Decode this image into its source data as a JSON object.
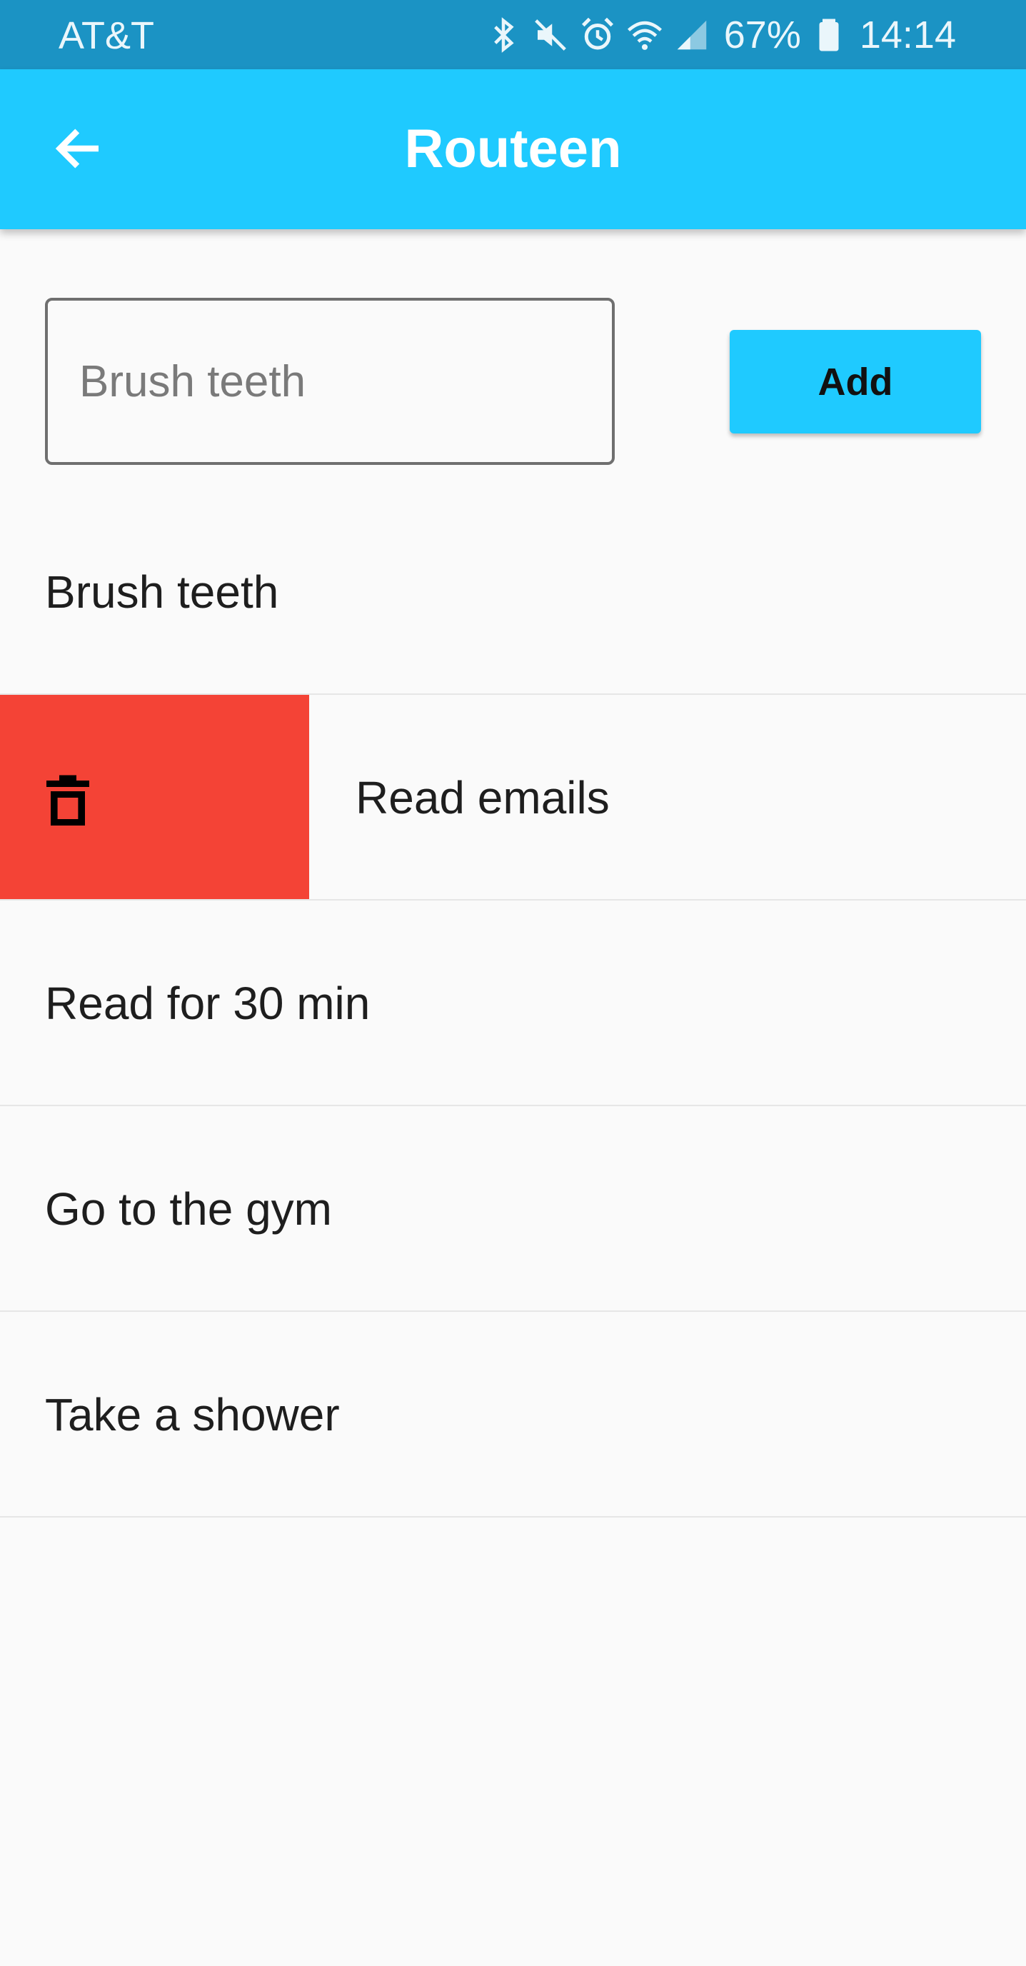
{
  "status_bar": {
    "carrier": "AT&T",
    "battery": "67%",
    "time": "14:14",
    "icons": [
      "bluetooth-icon",
      "mute-icon",
      "alarm-icon",
      "wifi-icon",
      "signal-icon",
      "battery-icon"
    ]
  },
  "app_bar": {
    "title": "Routeen",
    "back_icon": "arrow-back-icon"
  },
  "input": {
    "placeholder": "Brush teeth",
    "value": ""
  },
  "add_button": {
    "label": "Add"
  },
  "colors": {
    "status_bar": "#1b93c4",
    "app_bar": "#1fcaff",
    "delete": "#f44336",
    "background": "#fafafa"
  },
  "tasks": [
    {
      "label": "Brush teeth"
    },
    {
      "label": "Read emails",
      "swiped": true,
      "swipe_action_icon": "trash-icon"
    },
    {
      "label": "Read for 30 min"
    },
    {
      "label": "Go to the gym"
    },
    {
      "label": "Take a shower"
    }
  ]
}
